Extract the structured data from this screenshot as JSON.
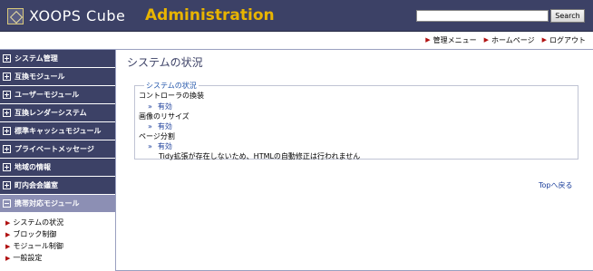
{
  "header": {
    "logo_text": "XOOPS Cube",
    "admin_text": "Administration",
    "search_value": "",
    "search_button": "Search"
  },
  "toplinks": [
    "管理メニュー",
    "ホームページ",
    "ログアウト"
  ],
  "sidebar": {
    "categories": [
      {
        "label": "システム管理",
        "state": "plus"
      },
      {
        "label": "互換モジュール",
        "state": "plus"
      },
      {
        "label": "ユーザーモジュール",
        "state": "plus"
      },
      {
        "label": "互換レンダーシステム",
        "state": "plus"
      },
      {
        "label": "標準キャッシュモジュール",
        "state": "plus"
      },
      {
        "label": "プライベートメッセージ",
        "state": "plus"
      },
      {
        "label": "地域の情報",
        "state": "plus"
      },
      {
        "label": "町内会会議室",
        "state": "plus"
      },
      {
        "label": "携帯対応モジュール",
        "state": "minus"
      }
    ],
    "submenu": [
      "システムの状況",
      "ブロック制御",
      "モジュール制御",
      "一般設定"
    ]
  },
  "main": {
    "title": "システムの状況",
    "box_legend": "システムの状況",
    "items": [
      {
        "title": "コントローラの換装",
        "value": "有効"
      },
      {
        "title": "画像のリサイズ",
        "value": "有効"
      },
      {
        "title": "ページ分割",
        "value": "有効"
      }
    ],
    "note": "Tidy拡張が存在しないため、HTMLの自動修正は行われません",
    "to_top": "Topへ戻る",
    "quote_mark": "»"
  },
  "colors": {
    "header_bg": "#3c4166",
    "accent": "#e8b400",
    "active_category": "#8c8fb4",
    "link": "#1a3d9a"
  }
}
